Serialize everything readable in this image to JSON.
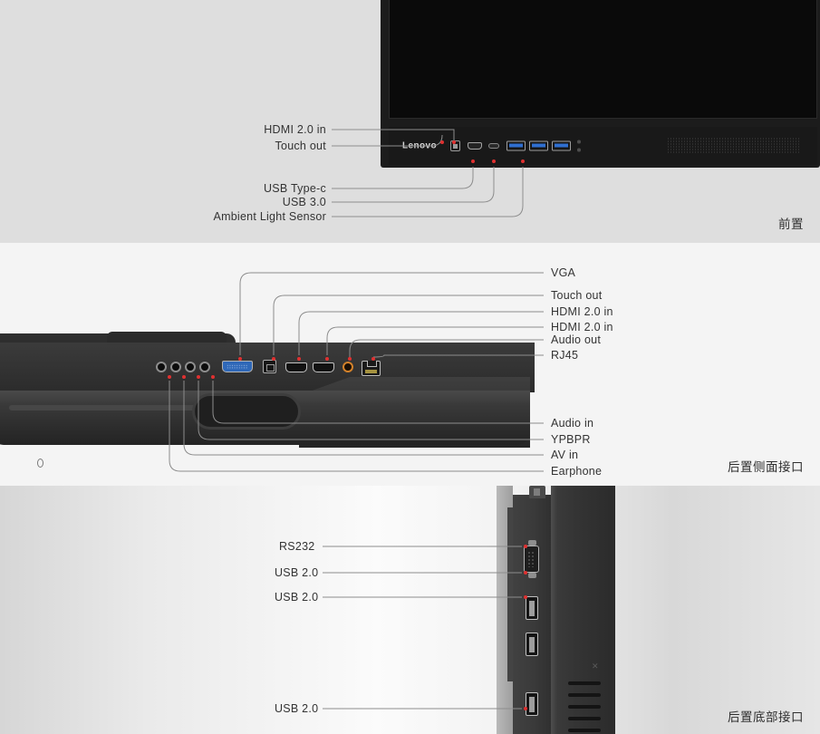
{
  "diagram": {
    "brand": "Lenovo",
    "accent_dot_color": "#e03030",
    "leader_line_color": "#8d8d8d",
    "label_text_color": "#333333"
  },
  "sections": [
    {
      "id": "front",
      "caption": "前置",
      "background": "#dedede",
      "labels": [
        {
          "text": "HDMI 2.0 in",
          "align": "right"
        },
        {
          "text": "Touch out",
          "align": "right"
        },
        {
          "text": "USB Type-c",
          "align": "right"
        },
        {
          "text": "USB 3.0",
          "align": "right"
        },
        {
          "text": "Ambient Light Sensor",
          "align": "right"
        }
      ],
      "ports": [
        {
          "name": "touch-out-port",
          "type": "touch-square"
        },
        {
          "name": "hdmi-in-port",
          "type": "hdmi"
        },
        {
          "name": "usb-type-c-port",
          "type": "usb-c"
        },
        {
          "name": "usb-3-0-port-1",
          "type": "usb3"
        },
        {
          "name": "usb-3-0-port-2",
          "type": "usb3"
        },
        {
          "name": "usb-3-0-port-3",
          "type": "usb3"
        },
        {
          "name": "ambient-light-sensor",
          "type": "sensor"
        }
      ]
    },
    {
      "id": "rear-side",
      "caption": "后置侧面接口",
      "background": "#f4f4f4",
      "labels_right": [
        {
          "text": "VGA"
        },
        {
          "text": "Touch out"
        },
        {
          "text": "HDMI 2.0 in"
        },
        {
          "text": "HDMI 2.0 in"
        },
        {
          "text": "Audio out"
        },
        {
          "text": "RJ45"
        },
        {
          "text": "Audio in"
        },
        {
          "text": "YPBPR"
        },
        {
          "text": "AV in"
        },
        {
          "text": "Earphone"
        }
      ],
      "ports": [
        {
          "name": "earphone-jack",
          "type": "jack"
        },
        {
          "name": "av-in-jack",
          "type": "jack"
        },
        {
          "name": "ypbpr-jack",
          "type": "jack"
        },
        {
          "name": "audio-in-jack",
          "type": "jack"
        },
        {
          "name": "vga-port",
          "type": "vga"
        },
        {
          "name": "touch-out-usb-b",
          "type": "usb-b"
        },
        {
          "name": "hdmi-in-port-1",
          "type": "hdmi"
        },
        {
          "name": "hdmi-in-port-2",
          "type": "hdmi"
        },
        {
          "name": "audio-out-jack",
          "type": "jack-orange"
        },
        {
          "name": "rj45-port",
          "type": "rj45"
        }
      ]
    },
    {
      "id": "rear-bottom",
      "caption": "后置底部接口",
      "labels": [
        {
          "text": "RS232"
        },
        {
          "text": "USB 2.0"
        },
        {
          "text": "USB 2.0"
        },
        {
          "text": "USB 2.0"
        }
      ],
      "ports": [
        {
          "name": "rs232-port",
          "type": "db9"
        },
        {
          "name": "usb-2-0-port-1",
          "type": "usb-a"
        },
        {
          "name": "usb-2-0-port-2",
          "type": "usb-a"
        },
        {
          "name": "usb-2-0-port-3",
          "type": "usb-a"
        }
      ]
    }
  ]
}
